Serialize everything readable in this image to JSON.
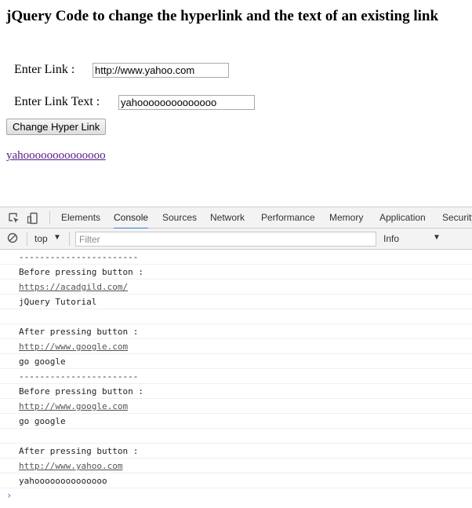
{
  "page": {
    "title": "jQuery Code to change the hyperlink and the text of an existing link",
    "link_label": "Enter Link :",
    "link_value": "http://www.yahoo.com",
    "text_label": "Enter Link Text :",
    "text_value": "yahoooooooooooooo",
    "button_label": "Change Hyper Link",
    "result_link_text": "yahoooooooooooooo",
    "link_color": "#551a8b"
  },
  "devtools": {
    "tabs": [
      "Elements",
      "Console",
      "Sources",
      "Network",
      "Performance",
      "Memory",
      "Application",
      "Security"
    ],
    "active_tab": "Console",
    "accent_color": "#3879d9",
    "icons": [
      "inspect-element-icon",
      "device-toolbar-icon",
      "clear-console-icon"
    ],
    "context": "top",
    "filter_placeholder": "Filter",
    "log_level": "Info",
    "console_lines": [
      {
        "text": "-----------------------",
        "link": false
      },
      {
        "text": "Before pressing button :",
        "link": false
      },
      {
        "text": "https://acadgild.com/",
        "link": true
      },
      {
        "text": "jQuery Tutorial",
        "link": false
      },
      {
        "text": "",
        "link": false
      },
      {
        "text": "After pressing button :",
        "link": false
      },
      {
        "text": "http://www.google.com",
        "link": true
      },
      {
        "text": "go google",
        "link": false
      },
      {
        "text": "-----------------------",
        "link": false
      },
      {
        "text": "Before pressing button :",
        "link": false
      },
      {
        "text": "http://www.google.com",
        "link": true
      },
      {
        "text": "go google",
        "link": false
      },
      {
        "text": "",
        "link": false
      },
      {
        "text": "After pressing button :",
        "link": false
      },
      {
        "text": "http://www.yahoo.com",
        "link": true
      },
      {
        "text": "yahoooooooooooooo",
        "link": false
      }
    ],
    "prompt_symbol": "›"
  }
}
